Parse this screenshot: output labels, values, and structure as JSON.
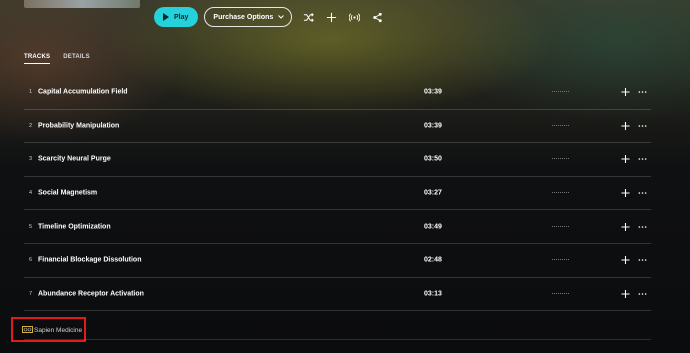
{
  "actions": {
    "play_label": "Play",
    "purchase_label": "Purchase Options"
  },
  "icons": {
    "play": "play-icon",
    "purchase_chevron": "chevron-down-icon",
    "shuffle": "shuffle-icon",
    "add": "plus-icon",
    "cast": "broadcast-icon",
    "share": "share-icon",
    "track_add": "plus-icon",
    "track_more": "ellipsis-icon"
  },
  "tabs": [
    {
      "label": "TRACKS",
      "active": true
    },
    {
      "label": "DETAILS",
      "active": false
    }
  ],
  "tracks": [
    {
      "num": "1",
      "title": "Capital Accumulation Field",
      "duration": "03:39"
    },
    {
      "num": "2",
      "title": "Probability Manipulation",
      "duration": "03:39"
    },
    {
      "num": "3",
      "title": "Scarcity Neural Purge",
      "duration": "03:50"
    },
    {
      "num": "4",
      "title": "Social Magnetism",
      "duration": "03:27"
    },
    {
      "num": "5",
      "title": "Timeline Optimization",
      "duration": "03:49"
    },
    {
      "num": "6",
      "title": "Financial Blockage Dissolution",
      "duration": "02:48"
    },
    {
      "num": "7",
      "title": "Abundance Receptor Activation",
      "duration": "03:13"
    }
  ],
  "footer": {
    "label_name": "Sapien Medicine",
    "highlight_color": "#e01b1b"
  },
  "colors": {
    "accent": "#25d1da"
  }
}
